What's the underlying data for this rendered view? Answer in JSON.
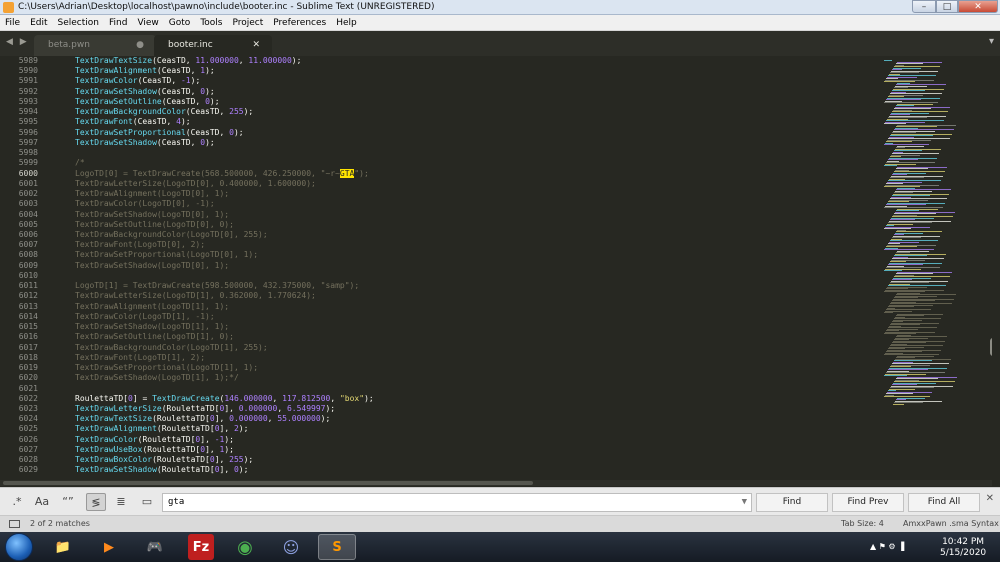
{
  "window": {
    "title": "C:\\Users\\Adrian\\Desktop\\localhost\\pawno\\include\\booter.inc - Sublime Text (UNREGISTERED)",
    "min": "–",
    "max": "□",
    "close": "✕"
  },
  "menu": [
    "File",
    "Edit",
    "Selection",
    "Find",
    "View",
    "Goto",
    "Tools",
    "Project",
    "Preferences",
    "Help"
  ],
  "tabs": {
    "nav_arrows": "◀ ▶",
    "inactive": {
      "label": "beta.pwn",
      "mark": "●"
    },
    "active": {
      "label": "booter.inc",
      "mark": "✕"
    },
    "chevron": "▾"
  },
  "editor": {
    "current_line": "6000",
    "line_numbers": [
      "5989",
      "5990",
      "5991",
      "5992",
      "5993",
      "5994",
      "5995",
      "5996",
      "5997",
      "5998",
      "5999",
      "6000",
      "6001",
      "6002",
      "6003",
      "6004",
      "6005",
      "6006",
      "6007",
      "6008",
      "6009",
      "6010",
      "6011",
      "6012",
      "6013",
      "6014",
      "6015",
      "6016",
      "6017",
      "6018",
      "6019",
      "6020",
      "6021",
      "6022",
      "6023",
      "6024",
      "6025",
      "6026",
      "6027",
      "6028",
      "6029"
    ],
    "lines": [
      [
        [
          "fn",
          "TextDrawTextSize"
        ],
        [
          "var",
          "(CeasTD, "
        ],
        [
          "num",
          "11.000000"
        ],
        [
          "var",
          ", "
        ],
        [
          "num",
          "11.000000"
        ],
        [
          "var",
          ");"
        ]
      ],
      [
        [
          "fn",
          "TextDrawAlignment"
        ],
        [
          "var",
          "(CeasTD, "
        ],
        [
          "num",
          "1"
        ],
        [
          "var",
          ");"
        ]
      ],
      [
        [
          "fn",
          "TextDrawColor"
        ],
        [
          "var",
          "(CeasTD, "
        ],
        [
          "num",
          "-1"
        ],
        [
          "var",
          ");"
        ]
      ],
      [
        [
          "fn",
          "TextDrawSetShadow"
        ],
        [
          "var",
          "(CeasTD, "
        ],
        [
          "num",
          "0"
        ],
        [
          "var",
          ");"
        ]
      ],
      [
        [
          "fn",
          "TextDrawSetOutline"
        ],
        [
          "var",
          "(CeasTD, "
        ],
        [
          "num",
          "0"
        ],
        [
          "var",
          ");"
        ]
      ],
      [
        [
          "fn",
          "TextDrawBackgroundColor"
        ],
        [
          "var",
          "(CeasTD, "
        ],
        [
          "num",
          "255"
        ],
        [
          "var",
          ");"
        ]
      ],
      [
        [
          "fn",
          "TextDrawFont"
        ],
        [
          "var",
          "(CeasTD, "
        ],
        [
          "num",
          "4"
        ],
        [
          "var",
          ");"
        ]
      ],
      [
        [
          "fn",
          "TextDrawSetProportional"
        ],
        [
          "var",
          "(CeasTD, "
        ],
        [
          "num",
          "0"
        ],
        [
          "var",
          ");"
        ]
      ],
      [
        [
          "fn",
          "TextDrawSetShadow"
        ],
        [
          "var",
          "(CeasTD, "
        ],
        [
          "num",
          "0"
        ],
        [
          "var",
          ");"
        ]
      ],
      [],
      [
        [
          "c",
          "/*"
        ]
      ],
      [
        [
          "c",
          "LogoTD[0] = TextDrawCreate(568.500000, 426.250000, \"~r~"
        ],
        [
          "hl",
          "GTA"
        ],
        [
          "c",
          "\");"
        ]
      ],
      [
        [
          "c",
          "TextDrawLetterSize(LogoTD[0], 0.400000, 1.600000);"
        ]
      ],
      [
        [
          "c",
          "TextDrawAlignment(LogoTD[0], 1);"
        ]
      ],
      [
        [
          "c",
          "TextDrawColor(LogoTD[0], -1);"
        ]
      ],
      [
        [
          "c",
          "TextDrawSetShadow(LogoTD[0], 1);"
        ]
      ],
      [
        [
          "c",
          "TextDrawSetOutline(LogoTD[0], 0);"
        ]
      ],
      [
        [
          "c",
          "TextDrawBackgroundColor(LogoTD[0], 255);"
        ]
      ],
      [
        [
          "c",
          "TextDrawFont(LogoTD[0], 2);"
        ]
      ],
      [
        [
          "c",
          "TextDrawSetProportional(LogoTD[0], 1);"
        ]
      ],
      [
        [
          "c",
          "TextDrawSetShadow(LogoTD[0], 1);"
        ]
      ],
      [],
      [
        [
          "c",
          "LogoTD[1] = TextDrawCreate(598.500000, 432.375000, \"samp\");"
        ]
      ],
      [
        [
          "c",
          "TextDrawLetterSize(LogoTD[1], 0.362000, 1.770624);"
        ]
      ],
      [
        [
          "c",
          "TextDrawAlignment(LogoTD[1], 1);"
        ]
      ],
      [
        [
          "c",
          "TextDrawColor(LogoTD[1], -1);"
        ]
      ],
      [
        [
          "c",
          "TextDrawSetShadow(LogoTD[1], 1);"
        ]
      ],
      [
        [
          "c",
          "TextDrawSetOutline(LogoTD[1], 0);"
        ]
      ],
      [
        [
          "c",
          "TextDrawBackgroundColor(LogoTD[1], 255);"
        ]
      ],
      [
        [
          "c",
          "TextDrawFont(LogoTD[1], 2);"
        ]
      ],
      [
        [
          "c",
          "TextDrawSetProportional(LogoTD[1], 1);"
        ]
      ],
      [
        [
          "c",
          "TextDrawSetShadow(LogoTD[1], 1);*/"
        ]
      ],
      [],
      [
        [
          "var",
          "RoulettaTD["
        ],
        [
          "num",
          "0"
        ],
        [
          "var",
          "] = "
        ],
        [
          "fn",
          "TextDrawCreate"
        ],
        [
          "var",
          "("
        ],
        [
          "num",
          "146.000000"
        ],
        [
          "var",
          ", "
        ],
        [
          "num",
          "117.812500"
        ],
        [
          "var",
          ", "
        ],
        [
          "str",
          "\"box\""
        ],
        [
          "var",
          ");"
        ]
      ],
      [
        [
          "fn",
          "TextDrawLetterSize"
        ],
        [
          "var",
          "(RoulettaTD["
        ],
        [
          "num",
          "0"
        ],
        [
          "var",
          "], "
        ],
        [
          "num",
          "0.000000"
        ],
        [
          "var",
          ", "
        ],
        [
          "num",
          "6.549997"
        ],
        [
          "var",
          ");"
        ]
      ],
      [
        [
          "fn",
          "TextDrawTextSize"
        ],
        [
          "var",
          "(RoulettaTD["
        ],
        [
          "num",
          "0"
        ],
        [
          "var",
          "], "
        ],
        [
          "num",
          "0.000000"
        ],
        [
          "var",
          ", "
        ],
        [
          "num",
          "55.000000"
        ],
        [
          "var",
          ");"
        ]
      ],
      [
        [
          "fn",
          "TextDrawAlignment"
        ],
        [
          "var",
          "(RoulettaTD["
        ],
        [
          "num",
          "0"
        ],
        [
          "var",
          "], "
        ],
        [
          "num",
          "2"
        ],
        [
          "var",
          ");"
        ]
      ],
      [
        [
          "fn",
          "TextDrawColor"
        ],
        [
          "var",
          "(RoulettaTD["
        ],
        [
          "num",
          "0"
        ],
        [
          "var",
          "], "
        ],
        [
          "num",
          "-1"
        ],
        [
          "var",
          ");"
        ]
      ],
      [
        [
          "fn",
          "TextDrawUseBox"
        ],
        [
          "var",
          "(RoulettaTD["
        ],
        [
          "num",
          "0"
        ],
        [
          "var",
          "], "
        ],
        [
          "num",
          "1"
        ],
        [
          "var",
          ");"
        ]
      ],
      [
        [
          "fn",
          "TextDrawBoxColor"
        ],
        [
          "var",
          "(RoulettaTD["
        ],
        [
          "num",
          "0"
        ],
        [
          "var",
          "], "
        ],
        [
          "num",
          "255"
        ],
        [
          "var",
          ");"
        ]
      ],
      [
        [
          "fn",
          "TextDrawSetShadow"
        ],
        [
          "var",
          "(RoulettaTD["
        ],
        [
          "num",
          "0"
        ],
        [
          "var",
          "], "
        ],
        [
          "num",
          "0"
        ],
        [
          "var",
          ");"
        ]
      ]
    ]
  },
  "find": {
    "regex_label": ".*",
    "case_label": "Aa",
    "word_label": "“”",
    "wrap_label": "≶",
    "selection_label": "≣",
    "highlight_label": "▭",
    "query": "gta",
    "dropdown": "▼",
    "find_label": "Find",
    "find_prev_label": "Find Prev",
    "find_all_label": "Find All",
    "close": "✕"
  },
  "status": {
    "matches": "2 of 2 matches",
    "tab_size": "Tab Size: 4",
    "syntax": "AmxxPawn .sma Syntax"
  },
  "taskbar": {
    "apps": [
      {
        "name": "file-explorer",
        "glyph": "📁"
      },
      {
        "name": "media-player",
        "glyph": "▶"
      },
      {
        "name": "gamepad",
        "glyph": "🎮"
      },
      {
        "name": "filezilla",
        "glyph": "Fz"
      },
      {
        "name": "chrome",
        "glyph": "◉"
      },
      {
        "name": "discord",
        "glyph": "☺"
      },
      {
        "name": "sublime-text",
        "glyph": "S"
      }
    ],
    "tray_icons": "▲  ⚑  ⚙  ▐",
    "time": "10:42 PM",
    "date": "5/15/2020"
  },
  "colors": {
    "editor_bg": "#272822",
    "comment": "#75715e",
    "function": "#66d9ef",
    "number": "#ae81ff",
    "string": "#e6db74",
    "match_highlight": "#ffe400"
  }
}
